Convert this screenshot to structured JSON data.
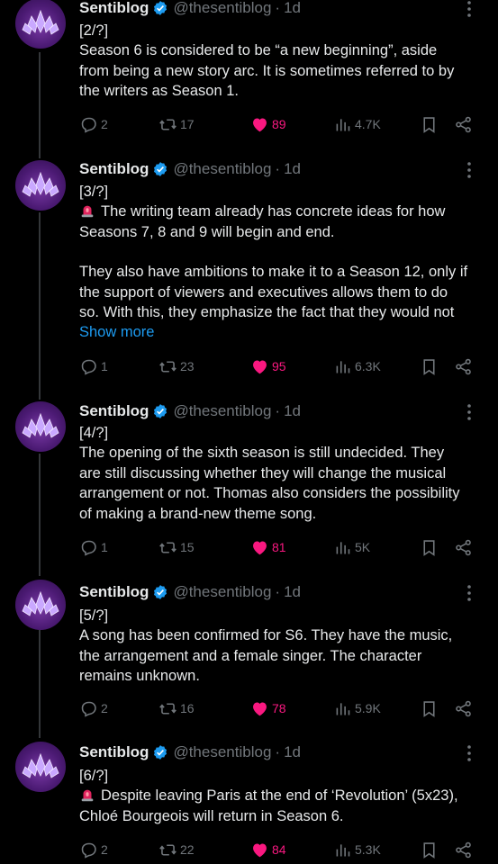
{
  "tweets": [
    {
      "name": "Sentiblog",
      "handle": "@thesentiblog",
      "time": "1d",
      "counter": "[2/?]",
      "text": [
        "Season 6 is considered to be “a new beginning”, aside",
        "from being a new story arc. It is sometimes referred to by",
        "the writers as Season 1."
      ],
      "replies": "2",
      "reposts": "17",
      "likes": "89",
      "views": "4.7K"
    },
    {
      "name": "Sentiblog",
      "handle": "@thesentiblog",
      "time": "1d",
      "counter": "[3/?]",
      "text": [
        "The writing team already has concrete ideas for how",
        "Seasons 7, 8 and 9 will begin and end."
      ],
      "text2": [
        "They also have ambitions to make it to a Season 12, only if",
        "the support of viewers and executives allows them to do",
        "so. With this, they emphasize the fact that they would not"
      ],
      "show_more": "Show more",
      "replies": "1",
      "reposts": "23",
      "likes": "95",
      "views": "6.3K"
    },
    {
      "name": "Sentiblog",
      "handle": "@thesentiblog",
      "time": "1d",
      "counter": "[4/?]",
      "text": [
        "The opening of the sixth season is still undecided. They",
        "are still discussing whether they will change the musical",
        "arrangement or not. Thomas also considers the possibility",
        "of making a brand-new theme song."
      ],
      "replies": "1",
      "reposts": "15",
      "likes": "81",
      "views": "5K"
    },
    {
      "name": "Sentiblog",
      "handle": "@thesentiblog",
      "time": "1d",
      "counter": "[5/?]",
      "text": [
        "A song has been confirmed for S6. They have the music,",
        "the arrangement and a female singer. The character",
        "remains unknown."
      ],
      "replies": "2",
      "reposts": "16",
      "likes": "78",
      "views": "5.9K"
    },
    {
      "name": "Sentiblog",
      "handle": "@thesentiblog",
      "time": "1d",
      "counter": "[6/?]",
      "text": [
        "Despite leaving Paris at the end of ‘Revolution’ (5x23),",
        "Chloé Bourgeois will return in Season 6."
      ],
      "replies": "2",
      "reposts": "22",
      "likes": "84",
      "views": "5.3K"
    }
  ],
  "colors": {
    "background": "#000000",
    "text": "#e7e9ea",
    "secondary": "#71767b",
    "link": "#1d9bf0",
    "like": "#f91880",
    "verified": "#1d9bf0",
    "thread_line": "#333639"
  },
  "icons": {
    "verified": "verified-badge-icon",
    "more": "more-dots-icon",
    "reply": "reply-icon",
    "repost": "repost-icon",
    "like": "heart-icon",
    "views": "views-icon",
    "bookmark": "bookmark-icon",
    "share": "share-icon",
    "alarm": "rotating-light-icon"
  }
}
